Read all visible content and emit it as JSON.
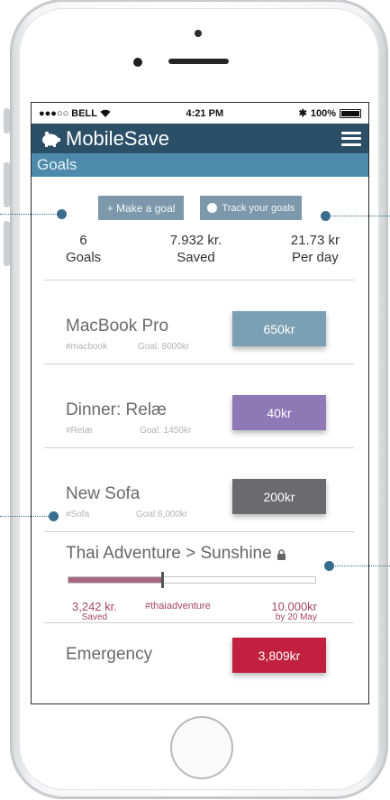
{
  "status": {
    "carrier": "●●●○○ BELL",
    "time": "4:21 PM",
    "bluetooth": "✱",
    "battery": "100%"
  },
  "app": {
    "title": "MobileSave",
    "logo_icon": "piggy-bank-icon",
    "menu_icon": "hamburger-menu-icon"
  },
  "section": {
    "title": "Goals"
  },
  "actions": {
    "make_goal": "+ Make a goal",
    "track_goals": "Track your goals"
  },
  "stats": [
    {
      "value": "6",
      "label": "Goals"
    },
    {
      "value": "7.932 kr.",
      "label": "Saved"
    },
    {
      "value": "21.73 kr",
      "label": "Per day"
    }
  ],
  "goals": [
    {
      "name": "MacBook Pro",
      "tag": "#macbook",
      "target": "Goal: 8000kr",
      "amount": "650kr",
      "color": "#7ba0b3"
    },
    {
      "name": "Dinner: Relæ",
      "tag": "#Relæ",
      "target": "Goal: 1450kr",
      "amount": "40kr",
      "color": "#8e78b6"
    },
    {
      "name": "New Sofa",
      "tag": "#Sofa",
      "target": "Goal:6,000kr",
      "amount": "200kr",
      "color": "#6b6b6e"
    }
  ],
  "featured": {
    "title": "Thai Adventure > Sunshine",
    "lock_icon": "lock-icon",
    "progress": 0.38,
    "saved_value": "3,242 kr.",
    "saved_label": "Saved",
    "hashtag": "#thaiadventure",
    "goal_value": "10.000kr",
    "goal_label": "by 20 May"
  },
  "emergency": {
    "name": "Emergency",
    "amount": "3,809kr",
    "color": "#c1203e"
  },
  "colors": {
    "appbar": "#2b4f67",
    "subbar": "#4d8aab",
    "accent": "#a54665",
    "callout": "#3a6c8d"
  }
}
